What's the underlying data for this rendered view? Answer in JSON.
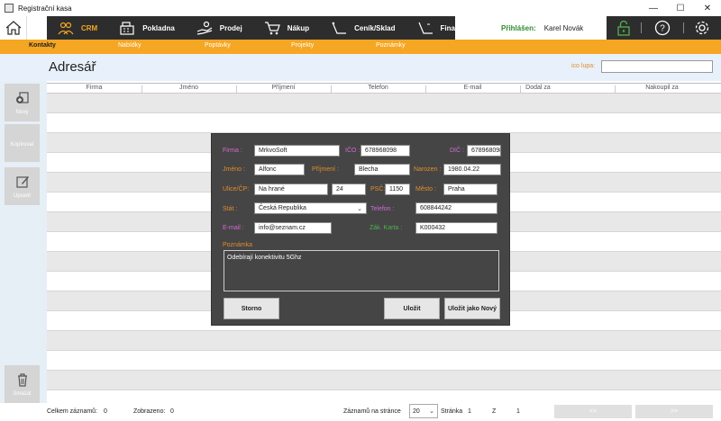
{
  "window": {
    "title": "Registrační kasa",
    "minimize": "—",
    "maximize": "☐",
    "close": "✕"
  },
  "topnav": {
    "items": [
      {
        "label": "CRM",
        "icon": "people-icon",
        "active": true
      },
      {
        "label": "Pokladna",
        "icon": "cash-register-icon",
        "active": false
      },
      {
        "label": "Prodej",
        "icon": "hand-coin-icon",
        "active": false
      },
      {
        "label": "Nákup",
        "icon": "cart-icon",
        "active": false
      },
      {
        "label": "Ceník/Sklad",
        "icon": "price-tag-icon",
        "active": false
      },
      {
        "label": "Finance",
        "icon": "finance-icon",
        "active": false
      }
    ],
    "login_label": "Přihlášen:",
    "login_user": "Karel Novák"
  },
  "subnav": {
    "items": [
      "Kontakty",
      "Nabídky",
      "Poptávky",
      "Projekty",
      "Poznámky"
    ],
    "active": "Kontakty"
  },
  "page": {
    "title": "Adresář",
    "search_label": "ico lupa:",
    "search_value": ""
  },
  "sidebar": {
    "buttons": [
      "Nový",
      "Kopírovat",
      "Upravit",
      "Smazat"
    ]
  },
  "table": {
    "columns": [
      "Firma",
      "Jméno",
      "Příjmení",
      "Telefon",
      "E-mail",
      "Dodal za",
      "Nakoupil za"
    ],
    "rows": []
  },
  "footer": {
    "total_label": "Celkem záznamů:",
    "total_value": "0",
    "shown_label": "Zobrazeno:",
    "shown_value": "0",
    "per_page_label": "Záznamů na stránce",
    "per_page_value": "20",
    "page_label": "Stránka",
    "page_value": "1",
    "of_label": "Z",
    "of_value": "1",
    "prev_label": "<<",
    "next_label": ">>"
  },
  "dialog": {
    "firma_label": "Firma :",
    "firma_value": "MrkvoSoft",
    "ico_label": "IČO :",
    "ico_value": "678968098",
    "dic_label": "DIČ :",
    "dic_value": "678968098",
    "jmeno_label": "Jméno :",
    "jmeno_value": "Alfonc",
    "prijmeni_label": "Příjmení :",
    "prijmeni_value": "Blecha",
    "narozen_label": "Narozen :",
    "narozen_value": "1980.04.22",
    "ulice_label": "Ulice/ČP:",
    "ulice_value": "Na hrané",
    "cp_value": "24",
    "psc_label": "PSČ:",
    "psc_value": "1150",
    "mesto_label": "Město :",
    "mesto_value": "Praha",
    "stat_label": "Stát :",
    "stat_value": "Česká Republika",
    "telefon_label": "Telefon :",
    "telefon_value": "608844242",
    "email_label": "E-mail :",
    "email_value": "info@seznam.cz",
    "karta_label": "Zák. Karta :",
    "karta_value": "K000432",
    "poznamka_label": "Poznámka",
    "poznamka_value": "Odebírají konektivitu 5Ghz",
    "storno_label": "Storno",
    "ulozit_label": "Uložit",
    "ulozit_novy_label": "Uložit jako Nový"
  },
  "colors": {
    "accent_orange": "#f5a623",
    "nav_dark": "#2d2d2d",
    "dialog_bg": "#454545",
    "label_pink": "#d36ad3",
    "label_orange": "#e38c2b",
    "label_green": "#4db34d",
    "login_green": "#2e8b2e"
  }
}
